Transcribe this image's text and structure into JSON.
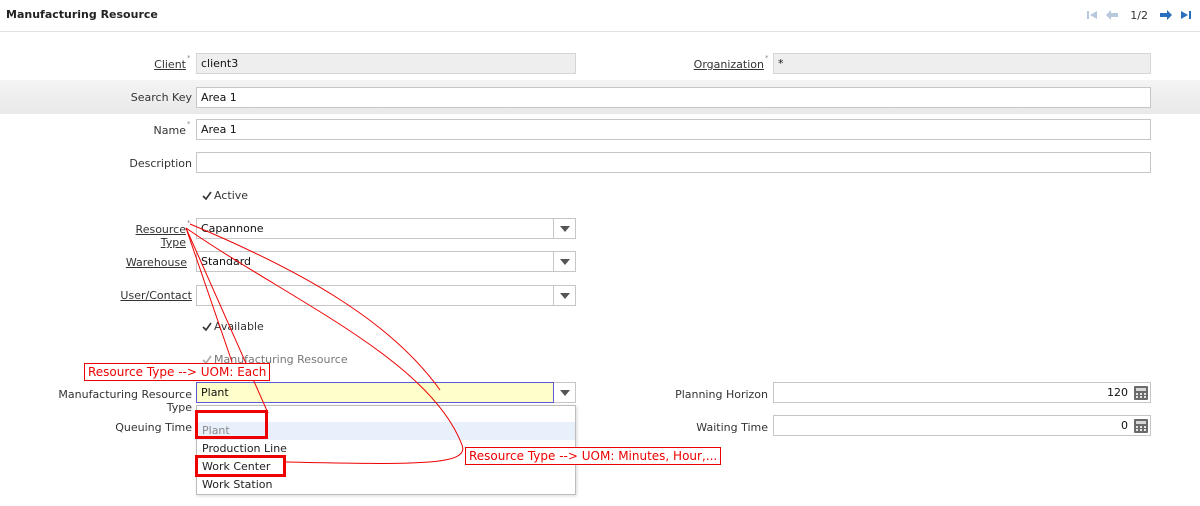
{
  "window": {
    "title": "Manufacturing Resource"
  },
  "pager": {
    "counter": "1/2"
  },
  "fields": {
    "client": {
      "label": "Client",
      "value": "client3"
    },
    "organization": {
      "label": "Organization",
      "value": "*"
    },
    "search_key": {
      "label": "Search Key",
      "value": "Area 1"
    },
    "name": {
      "label": "Name",
      "value": "Area 1"
    },
    "description": {
      "label": "Description",
      "value": ""
    },
    "active": {
      "label": "Active",
      "checked": true
    },
    "resource_type": {
      "label": "Resource Type",
      "value": "Capannone"
    },
    "warehouse": {
      "label": "Warehouse",
      "value": "Standard"
    },
    "user_contact": {
      "label": "User/Contact",
      "value": ""
    },
    "available": {
      "label": "Available",
      "checked": true
    },
    "manufacturing_resource": {
      "label": "Manufacturing Resource",
      "checked": true
    },
    "manufacturing_resource_type": {
      "label": "Manufacturing Resource Type",
      "value": "Plant"
    },
    "planning_horizon": {
      "label": "Planning Horizon",
      "value": "120"
    },
    "queuing_time": {
      "label": "Queuing Time"
    },
    "waiting_time": {
      "label": "Waiting Time",
      "value": "0"
    }
  },
  "dropdown": {
    "options": [
      "",
      "Plant",
      "Production Line",
      "Work Center",
      "Work Station"
    ],
    "selected": "Plant"
  },
  "annotations": {
    "note1": "Resource Type --> UOM: Each",
    "note2": "Resource Type --> UOM: Minutes, Hour,..."
  },
  "colors": {
    "annotation": "#ee0000",
    "nav_active": "#2a6fbd",
    "nav_disabled": "#b8c8dc"
  },
  "icons": [
    "first-record-icon",
    "previous-record-icon",
    "next-record-icon",
    "last-record-icon",
    "chevron-down-icon",
    "calculator-icon",
    "checkmark-icon"
  ]
}
